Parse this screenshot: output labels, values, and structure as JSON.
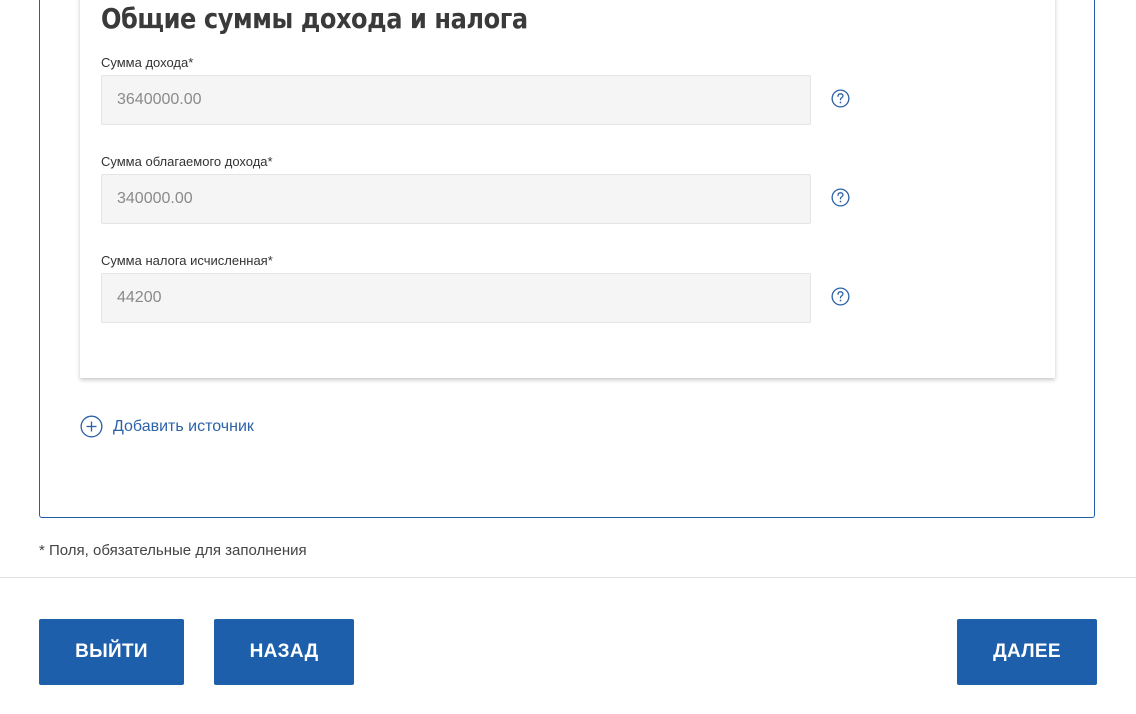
{
  "section": {
    "title": "Общие суммы дохода и налога"
  },
  "fields": [
    {
      "label": "Сумма дохода*",
      "value": "3640000.00"
    },
    {
      "label": "Сумма облагаемого дохода*",
      "value": "340000.00"
    },
    {
      "label": "Сумма налога исчисленная*",
      "value": "44200"
    }
  ],
  "add_source": {
    "label": "Добавить источник"
  },
  "required_note": "* Поля, обязательные для заполнения",
  "buttons": {
    "exit": "ВЫЙТИ",
    "back": "НАЗАД",
    "next": "ДАЛЕЕ"
  },
  "colors": {
    "accent": "#1d5fab",
    "border": "#1f5fa6",
    "link": "#2c63a8",
    "input_bg": "#f5f5f5"
  },
  "icons": {
    "help": "question-circle-icon",
    "add": "plus-circle-icon"
  }
}
